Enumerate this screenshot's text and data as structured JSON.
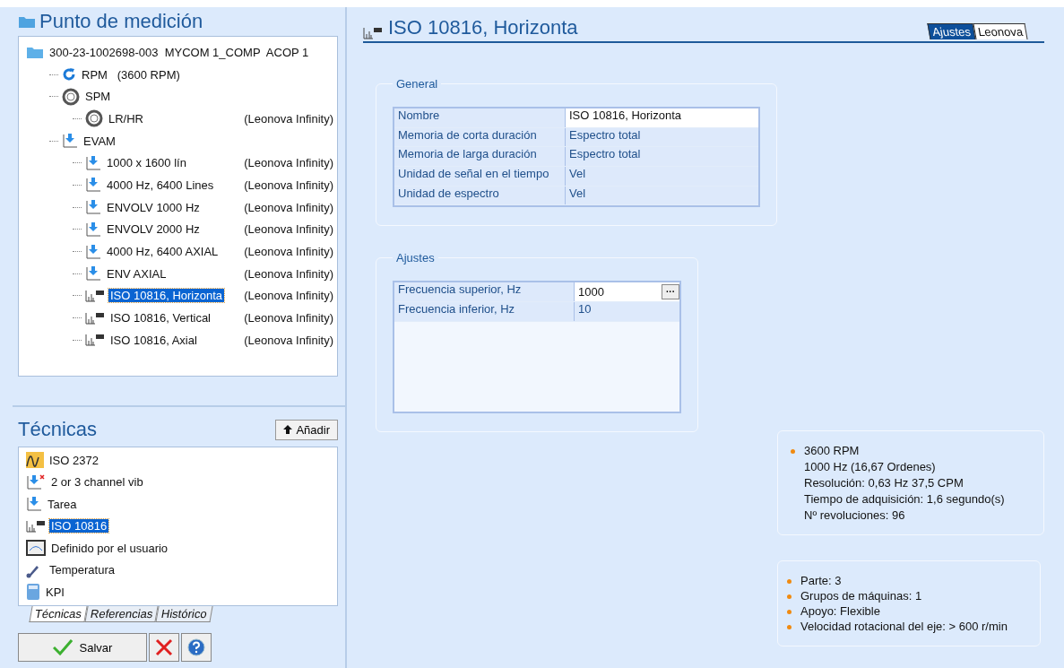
{
  "measurement_point": {
    "title": "Punto de medición",
    "tree": [
      {
        "label": "300-23-1002698-003  MYCOM 1_COMP  ACOP 1",
        "kind": "folder",
        "selected": false,
        "children": [
          {
            "label": "RPM   (3600 RPM)",
            "kind": "rpm",
            "selected": false
          },
          {
            "label": "SPM",
            "kind": "bearing",
            "selected": false,
            "children": [
              {
                "label": "LR/HR",
                "kind": "bearing",
                "note": "(Leonova Infinity)",
                "selected": false
              }
            ]
          },
          {
            "label": "EVAM",
            "kind": "evam",
            "selected": false,
            "children": [
              {
                "label": "1000 x 1600 lín",
                "kind": "evam",
                "note": "(Leonova Infinity)",
                "selected": false
              },
              {
                "label": "4000 Hz, 6400 Lines",
                "kind": "evam",
                "note": "(Leonova Infinity)",
                "selected": false
              },
              {
                "label": "ENVOLV 1000 Hz",
                "kind": "evam",
                "note": "(Leonova Infinity)",
                "selected": false
              },
              {
                "label": "ENVOLV 2000 Hz",
                "kind": "evam",
                "note": "(Leonova Infinity)",
                "selected": false
              },
              {
                "label": "4000 Hz, 6400 AXIAL",
                "kind": "evam",
                "note": "(Leonova Infinity)",
                "selected": false
              },
              {
                "label": "ENV AXIAL",
                "kind": "evam",
                "note": "(Leonova Infinity)",
                "selected": false
              },
              {
                "label": "ISO 10816, Horizonta",
                "kind": "iso",
                "note": "(Leonova Infinity)",
                "selected": true
              },
              {
                "label": "ISO 10816, Vertical",
                "kind": "iso",
                "note": "(Leonova Infinity)",
                "selected": false
              },
              {
                "label": "ISO 10816, Axial",
                "kind": "iso",
                "note": "(Leonova Infinity)",
                "selected": false
              }
            ]
          }
        ]
      }
    ]
  },
  "techniques": {
    "title": "Técnicas",
    "add_button": "Añadir",
    "items": [
      {
        "label": "ISO 2372",
        "kind": "iso2372",
        "selected": false
      },
      {
        "label": "2 or 3 channel vib",
        "kind": "evamx",
        "selected": false
      },
      {
        "label": "Tarea",
        "kind": "evam",
        "selected": false
      },
      {
        "label": "ISO 10816",
        "kind": "iso",
        "selected": true
      },
      {
        "label": "Definido por el usuario",
        "kind": "gauge",
        "selected": false
      },
      {
        "label": "Temperatura",
        "kind": "temp",
        "selected": false
      },
      {
        "label": "KPI",
        "kind": "kpi",
        "selected": false
      }
    ],
    "tabs": [
      {
        "label": "Técnicas",
        "selected": true
      },
      {
        "label": "Referencias",
        "selected": false
      },
      {
        "label": "Histórico",
        "selected": false
      }
    ],
    "save_button": "Salvar"
  },
  "detail": {
    "title": "ISO 10816, Horizonta",
    "tabs": [
      {
        "label": "Ajustes",
        "selected": true
      },
      {
        "label": "Leonova",
        "selected": false
      }
    ],
    "groups": [
      {
        "title": "General",
        "rows": [
          {
            "name": "Nombre",
            "value": "ISO 10816, Horizonta",
            "kind": "editable"
          },
          {
            "name": "Memoria de corta duración",
            "value": "Espectro total",
            "kind": "plain"
          },
          {
            "name": "Memoria de larga duración",
            "value": "Espectro total",
            "kind": "plain"
          },
          {
            "name": "Unidad de señal en el tiempo",
            "value": "Vel",
            "kind": "plain"
          },
          {
            "name": "Unidad de espectro",
            "value": "Vel",
            "kind": "plain"
          }
        ]
      },
      {
        "title": "Ajustes",
        "rows": [
          {
            "name": "Frecuencia superior, Hz",
            "value": "1000",
            "kind": "picker",
            "button": "···"
          },
          {
            "name": "Frecuencia inferior, Hz",
            "value": "10",
            "kind": "plain"
          }
        ]
      }
    ],
    "info_boxes": [
      {
        "items": [
          {
            "lines": [
              "3600 RPM",
              "1000 Hz (16,67 Ordenes)",
              "Resolución: 0,63 Hz  37,5 CPM",
              "Tiempo de adquisición: 1,6 segundo(s)",
              "Nº revoluciones: 96"
            ]
          }
        ]
      },
      {
        "items": [
          {
            "lines": [
              "Parte: 3"
            ]
          },
          {
            "lines": [
              "Grupos de máquinas: 1"
            ]
          },
          {
            "lines": [
              "Apoyo: Flexible"
            ]
          },
          {
            "lines": [
              "Velocidad rotacional del eje: > 600 r/min"
            ]
          }
        ]
      }
    ]
  }
}
